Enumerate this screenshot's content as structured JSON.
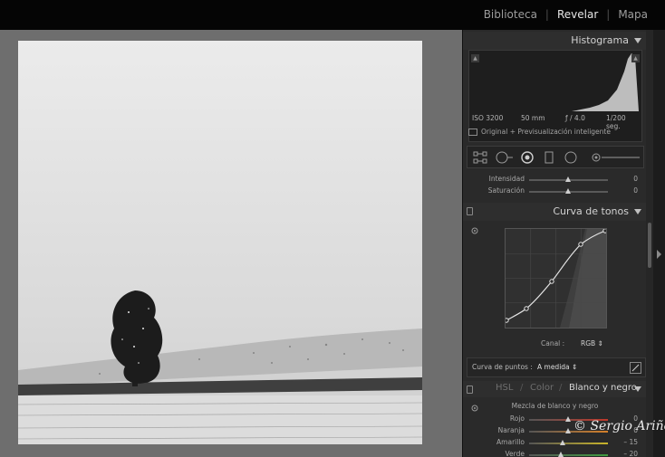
{
  "app": {
    "name": "Lightroom Develop"
  },
  "modules": [
    "Biblioteca",
    "Revelar",
    "Mapa"
  ],
  "active_module": "Revelar",
  "panels": {
    "histogram": {
      "title": "Histograma",
      "iso": "ISO 3200",
      "focal": "50 mm",
      "aperture": "ƒ / 4.0",
      "shutter": "1/200 seg.",
      "preview_label": "Original + Previsualización inteligente",
      "clip_marker": "▲"
    },
    "presence": {
      "sliders": [
        {
          "label": "Intensidad",
          "value": "0",
          "level": 0.5
        },
        {
          "label": "Saturación",
          "value": "0",
          "level": 0.5
        }
      ]
    },
    "tone_curve": {
      "title": "Curva de tonos",
      "channel_label": "Canal :",
      "channel_value": "RGB ⇕",
      "points_label": "Curva de puntos :",
      "points_value": "A medida ⇕"
    },
    "hsl": {
      "tabs": [
        "HSL",
        "Color",
        "Blanco y negro"
      ],
      "active_tab": "Blanco y negro",
      "mix_title": "Mezcla de blanco y negro",
      "sliders": [
        {
          "label": "Rojo",
          "value": "0",
          "level": 0.5,
          "color": "#c0392b"
        },
        {
          "label": "Naranja",
          "value": "0",
          "level": 0.5,
          "color": "#d4802a"
        },
        {
          "label": "Amarillo",
          "value": "– 15",
          "level": 0.43,
          "color": "#c9b42a"
        },
        {
          "label": "Verde",
          "value": "– 20",
          "level": 0.4,
          "color": "#3f9a3f"
        }
      ]
    }
  },
  "colors": {
    "accent": "#e6e6e6",
    "panel_bg": "#2a2a2a",
    "topbar": "#050505"
  },
  "watermark": "© Sergio Ariño"
}
